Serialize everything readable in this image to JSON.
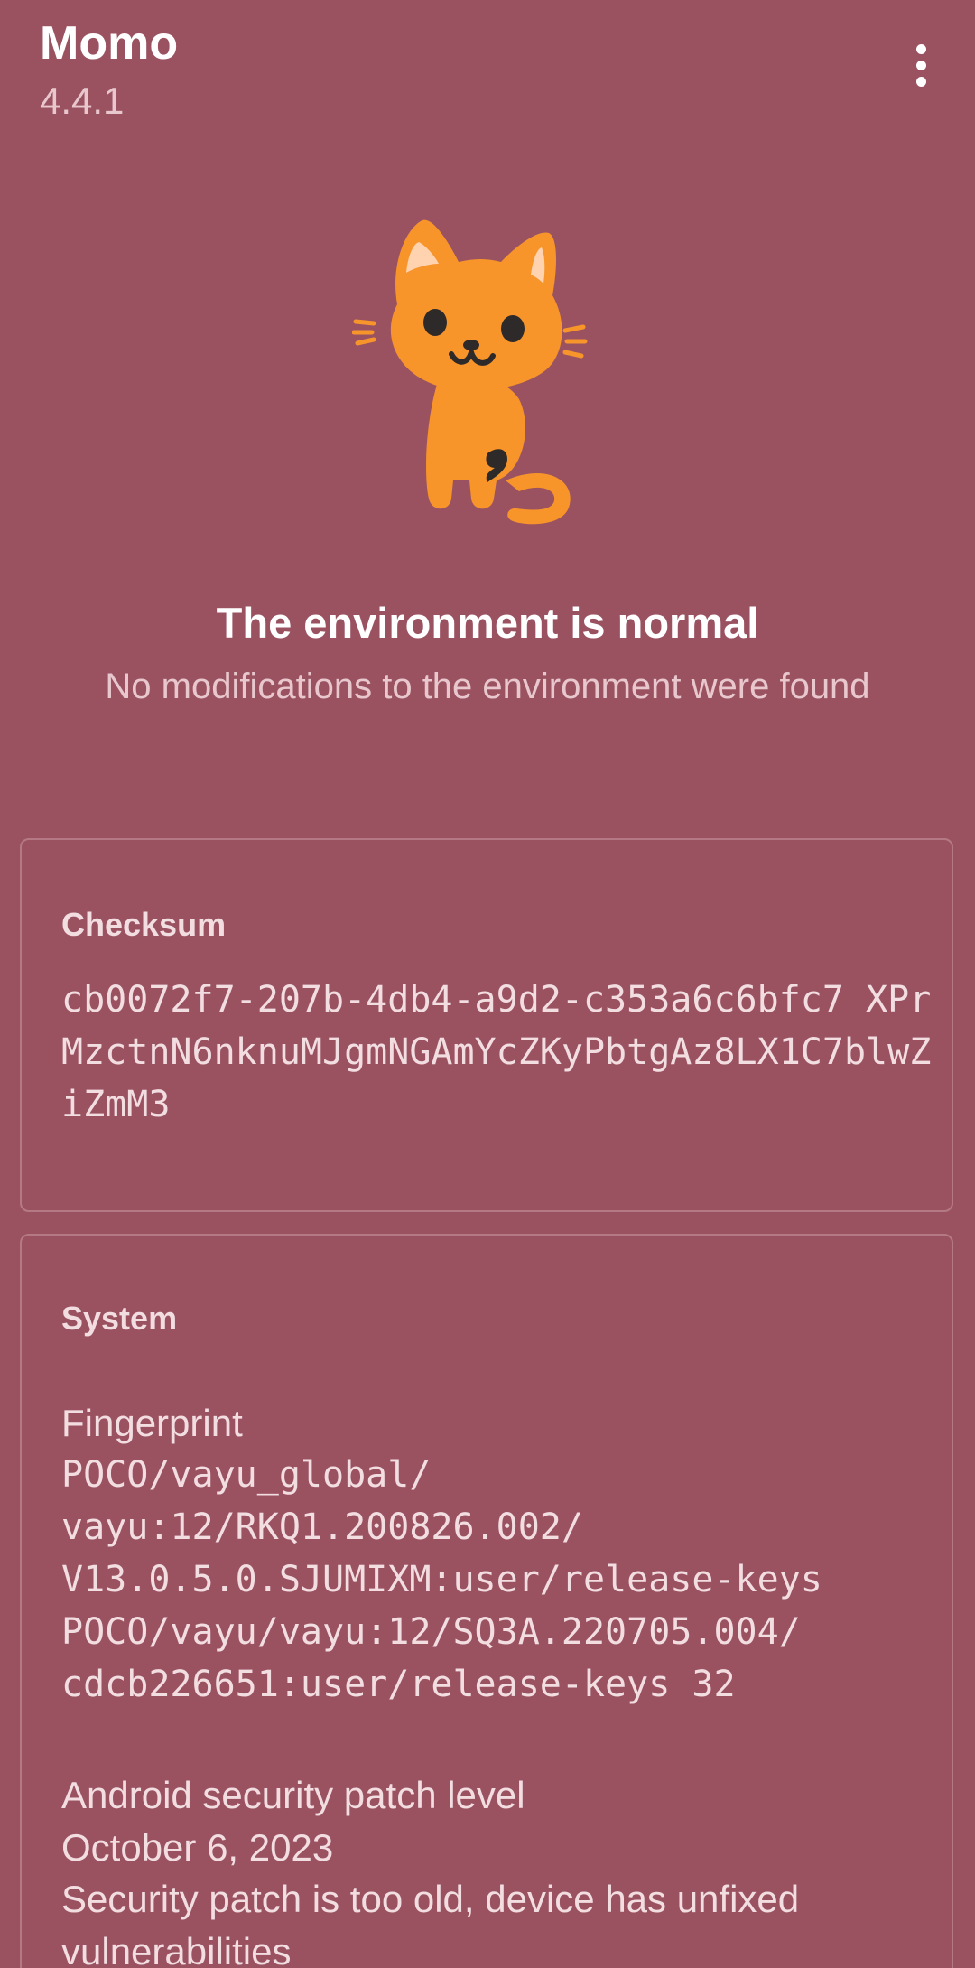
{
  "app": {
    "title": "Momo",
    "version": "4.4.1",
    "menu_icon": "more-vert-icon"
  },
  "status": {
    "icon": "cat-icon",
    "title": "The environment is normal",
    "subtitle": "No modifications to the environment were found"
  },
  "checksum": {
    "heading": "Checksum",
    "value": "cb0072f7-207b-4db4-a9d2-c353a6c6bfc7 XPrMzctnN6nknuMJgmNGAmYcZKyPbtgAz8LX1C7blwZiZmM3"
  },
  "system": {
    "heading": "System",
    "fingerprint_label": "Fingerprint",
    "fingerprint_value": "POCO/vayu_global/\nvayu:12/RKQ1.200826.002/\nV13.0.5.0.SJUMIXM:user/release-keys\nPOCO/vayu/vayu:12/SQ3A.220705.004/\ncdcb226651:user/release-keys 32",
    "patch_label": "Android security patch level",
    "patch_date": "October 6, 2023",
    "patch_warning": "Security patch is too old, device has unfixed vulnerabilities"
  },
  "colors": {
    "background": "#9a5261",
    "card_border": "#b47985",
    "text_primary": "#ffffff",
    "text_secondary": "#e8c7cd",
    "cat_body": "#f7952b"
  }
}
